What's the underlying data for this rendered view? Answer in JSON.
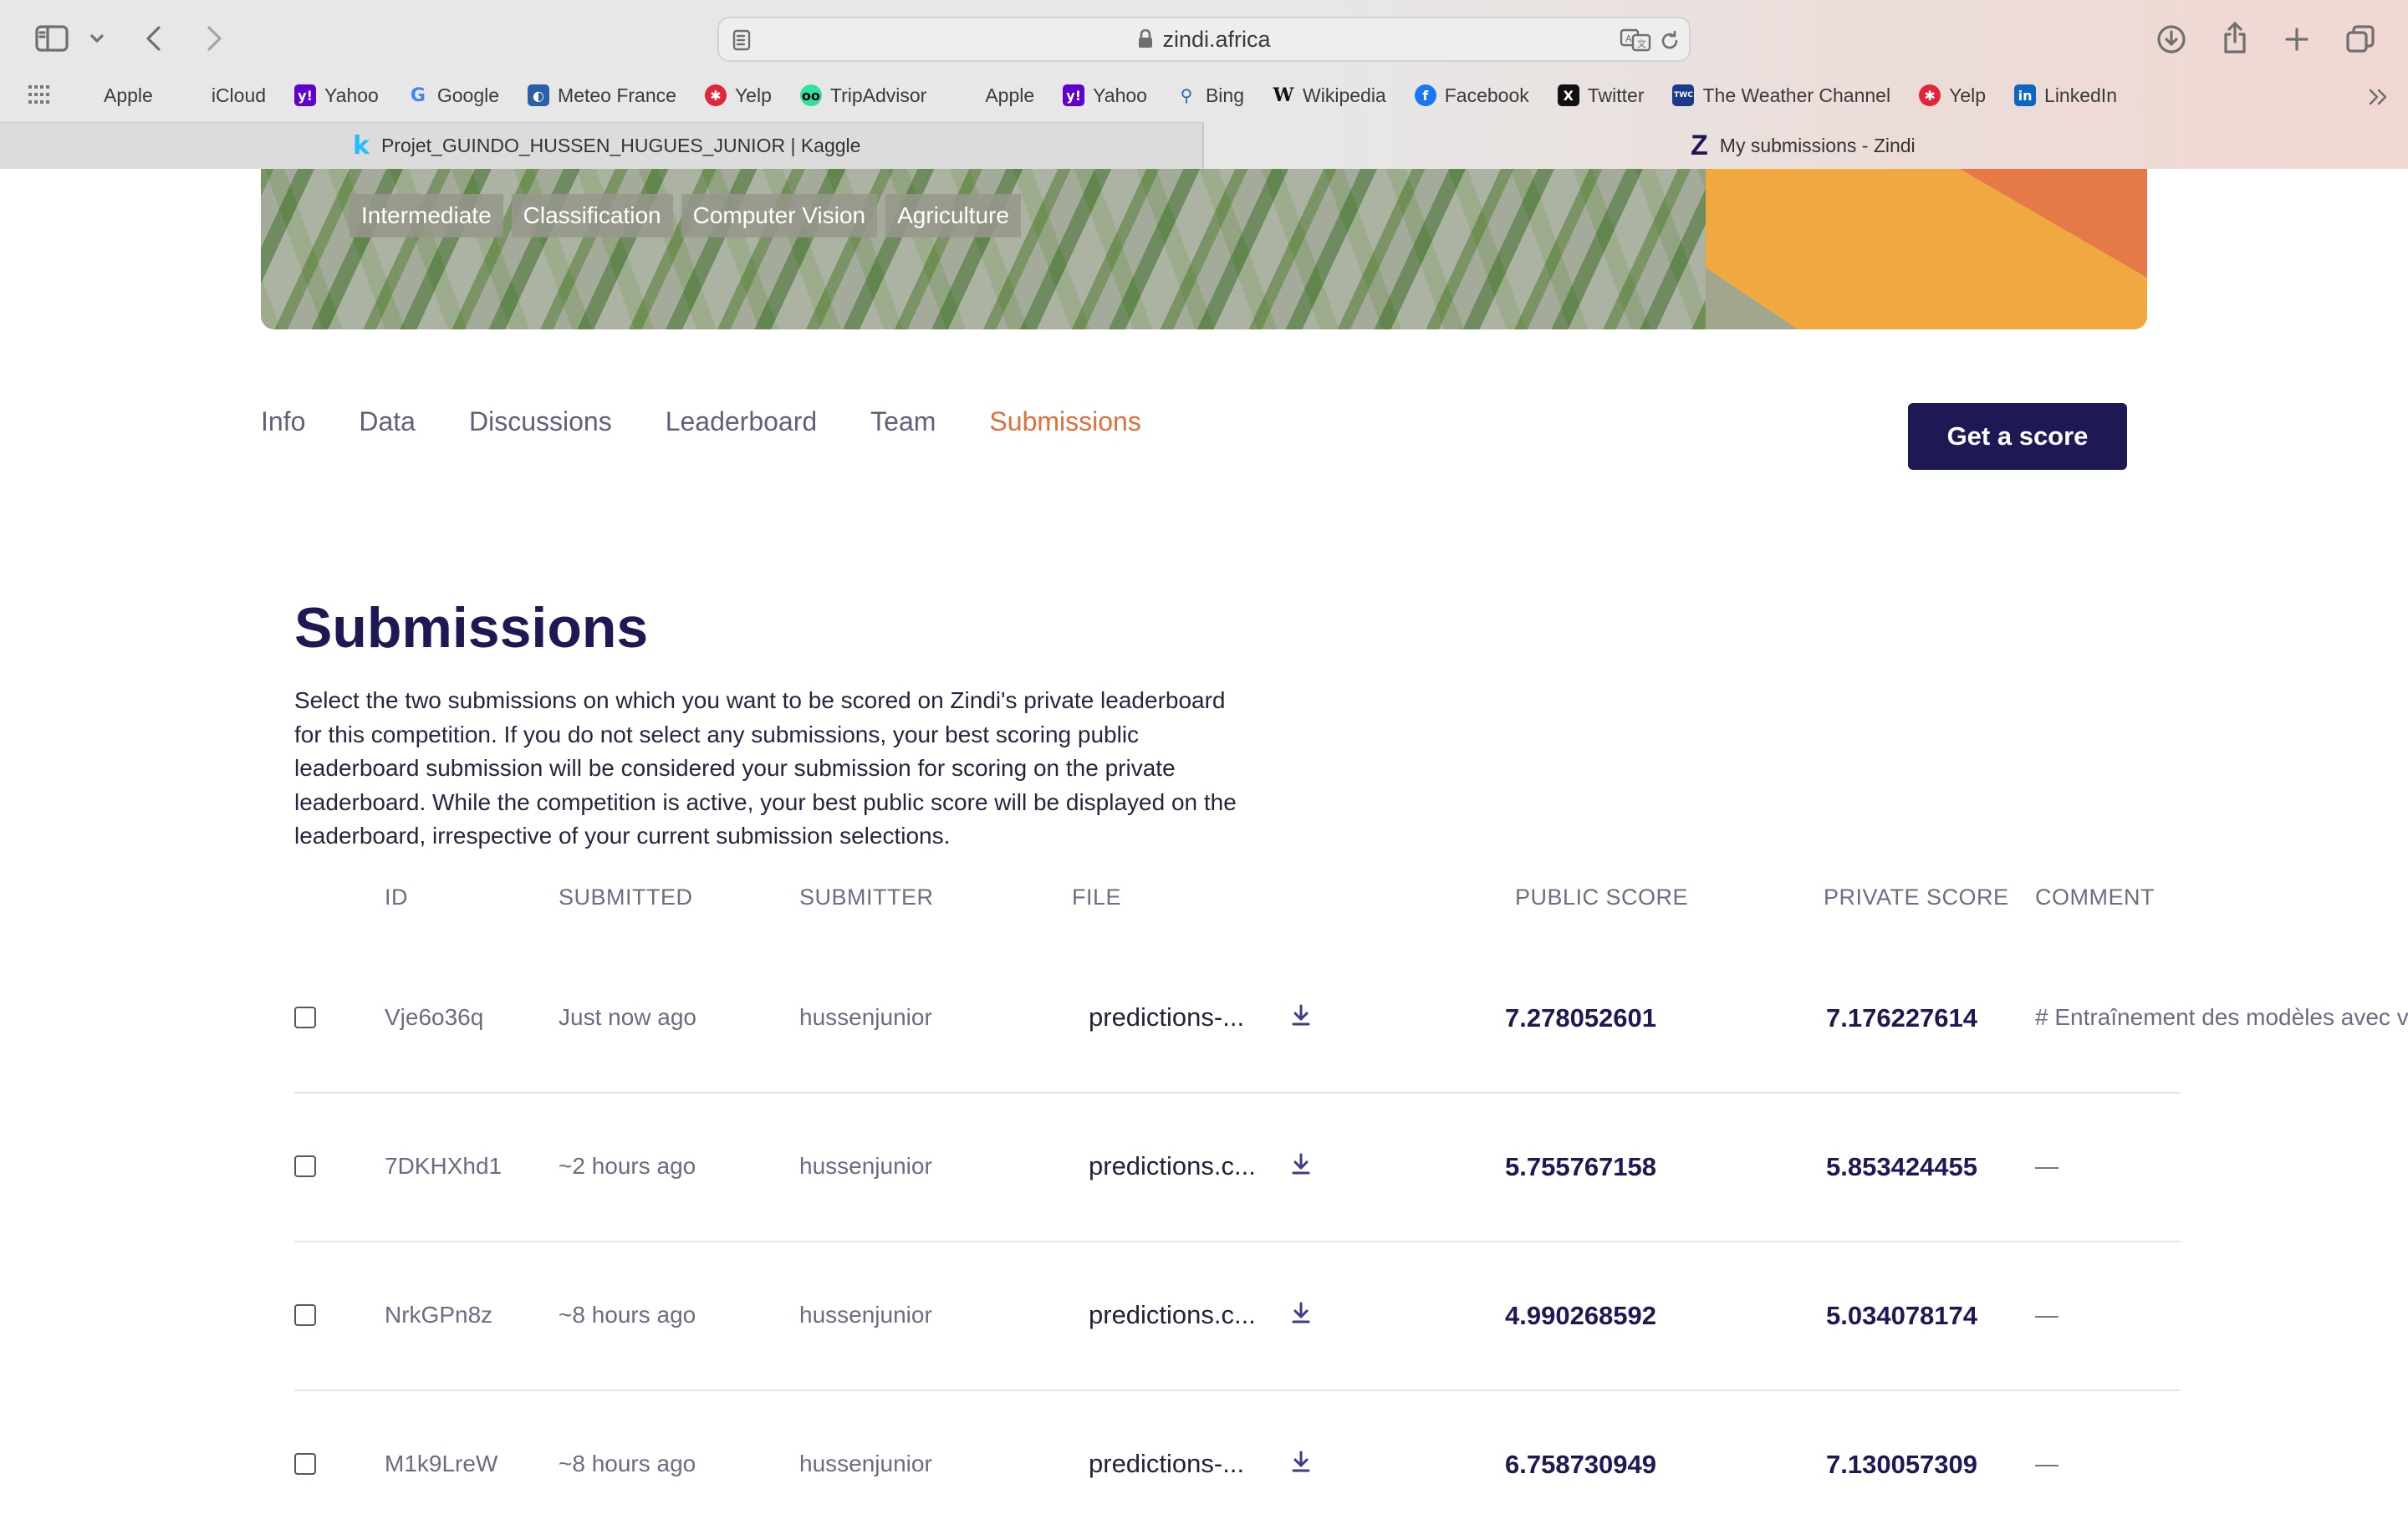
{
  "browser": {
    "url": "zindi.africa",
    "bookmarks": [
      {
        "label": "Apple",
        "icon": "apple-icon"
      },
      {
        "label": "iCloud",
        "icon": "apple-icon"
      },
      {
        "label": "Yahoo",
        "icon": "yahoo-icon"
      },
      {
        "label": "Google",
        "icon": "google-icon"
      },
      {
        "label": "Meteo France",
        "icon": "meteo-france-icon"
      },
      {
        "label": "Yelp",
        "icon": "yelp-icon"
      },
      {
        "label": "TripAdvisor",
        "icon": "tripadvisor-icon"
      },
      {
        "label": "Apple",
        "icon": "apple-icon"
      },
      {
        "label": "Yahoo",
        "icon": "yahoo-icon"
      },
      {
        "label": "Bing",
        "icon": "search-icon"
      },
      {
        "label": "Wikipedia",
        "icon": "wikipedia-icon"
      },
      {
        "label": "Facebook",
        "icon": "facebook-icon"
      },
      {
        "label": "Twitter",
        "icon": "x-icon"
      },
      {
        "label": "The Weather Channel",
        "icon": "weather-channel-icon"
      },
      {
        "label": "Yelp",
        "icon": "yelp-icon"
      },
      {
        "label": "LinkedIn",
        "icon": "linkedin-icon"
      }
    ],
    "tabs": [
      {
        "label": "Projet_GUINDO_HUSSEN_HUGUES_JUNIOR | Kaggle",
        "icon": "kaggle-icon"
      },
      {
        "label": "My submissions - Zindi",
        "icon": "zindi-icon"
      }
    ]
  },
  "hero": {
    "tags": [
      "Intermediate",
      "Classification",
      "Computer Vision",
      "Agriculture"
    ]
  },
  "nav": {
    "tabs": [
      "Info",
      "Data",
      "Discussions",
      "Leaderboard",
      "Team",
      "Submissions"
    ],
    "active": "Submissions",
    "cta": "Get a score"
  },
  "main": {
    "title": "Submissions",
    "description": "Select the two submissions on which you want to be scored on Zindi's private leaderboard for this competition. If you do not select any submissions, your best scoring public leaderboard submission will be considered your submission for scoring on the private leaderboard. While the competition is active, your best public score will be displayed on the leaderboard, irrespective of your current submission selections.",
    "columns": {
      "id": "ID",
      "submitted": "SUBMITTED",
      "submitter": "SUBMITTER",
      "file": "FILE",
      "public": "PUBLIC SCORE",
      "private": "PRIVATE SCORE",
      "comment": "COMMENT"
    },
    "rows": [
      {
        "id": "Vje6o36q",
        "submitted": "Just now ago",
        "submitter": "hussenjunior",
        "file": "predictions-...",
        "public": "7.278052601",
        "private": "7.176227614",
        "comment": "# Entraînement des modèles avec v"
      },
      {
        "id": "7DKHXhd1",
        "submitted": "~2 hours ago",
        "submitter": "hussenjunior",
        "file": "predictions.c...",
        "public": "5.755767158",
        "private": "5.853424455",
        "comment": "—"
      },
      {
        "id": "NrkGPn8z",
        "submitted": "~8 hours ago",
        "submitter": "hussenjunior",
        "file": "predictions.c...",
        "public": "4.990268592",
        "private": "5.034078174",
        "comment": "—"
      },
      {
        "id": "M1k9LreW",
        "submitted": "~8 hours ago",
        "submitter": "hussenjunior",
        "file": "predictions-...",
        "public": "6.758730949",
        "private": "7.130057309",
        "comment": "—"
      }
    ]
  },
  "colors": {
    "brand_navy": "#1d1954",
    "accent_orange": "#e0703a",
    "hero_orange": "#efa940"
  }
}
